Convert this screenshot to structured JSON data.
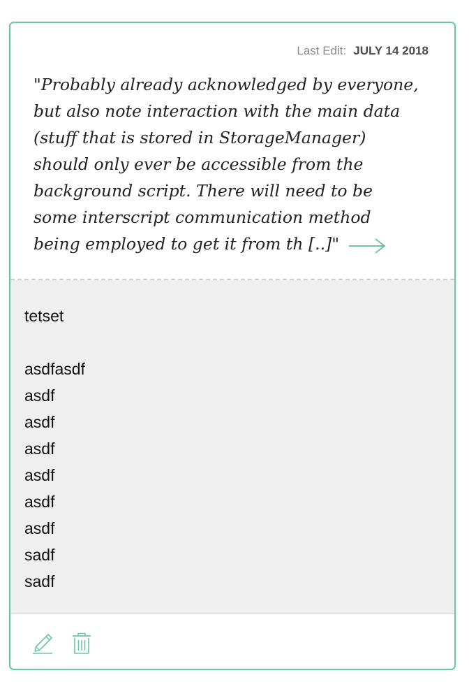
{
  "card": {
    "last_edit_label": "Last Edit:",
    "last_edit_date": "JULY 14 2018",
    "quote_lines": [
      "\"Probably already acknowledged by everyone,",
      "but also note interaction with the main data",
      "(stuff that is stored in StorageManager)",
      "should only ever be accessible from the",
      "background script. There will need to be",
      "some interscript communication method",
      "being employed to get it from th [..]\""
    ],
    "quote_link_icon": "arrow-right-icon",
    "note_lines": [
      "tetset",
      "",
      "asdfasdf",
      "asdf",
      "asdf",
      "asdf",
      "asdf",
      "asdf",
      "asdf",
      "sadf",
      "sadf"
    ],
    "actions": {
      "edit_icon": "pencil-icon",
      "delete_icon": "trash-icon"
    }
  },
  "colors": {
    "accent": "#6cc5a3",
    "note_background": "#efefef",
    "meta_label": "#8a8a8a",
    "meta_date": "#4a4a4a"
  }
}
